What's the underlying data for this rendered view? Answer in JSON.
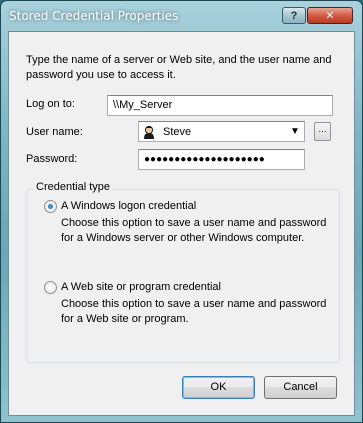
{
  "window": {
    "title": "Stored Credential Properties",
    "help_glyph": "?",
    "close_glyph": "✕"
  },
  "intro": "Type the name of a server or Web site, and the user name and password you use to access it.",
  "fields": {
    "logon_label": "Log on to:",
    "logon_value": "\\\\My_Server",
    "username_label": "User name:",
    "username_value": "Steve",
    "browse_label": "...",
    "password_label": "Password:",
    "password_value": "●●●●●●●●●●●●●●●●●●●●"
  },
  "credential_type": {
    "title": "Credential type",
    "options": [
      {
        "label": "A Windows logon credential",
        "description": "Choose this option to save a user name and password for a Windows server or other Windows computer.",
        "checked": true
      },
      {
        "label": "A Web site or program credential",
        "description": "Choose this option to save a user name and password for a Web site or program.",
        "checked": false
      }
    ]
  },
  "buttons": {
    "ok": "OK",
    "cancel": "Cancel"
  }
}
